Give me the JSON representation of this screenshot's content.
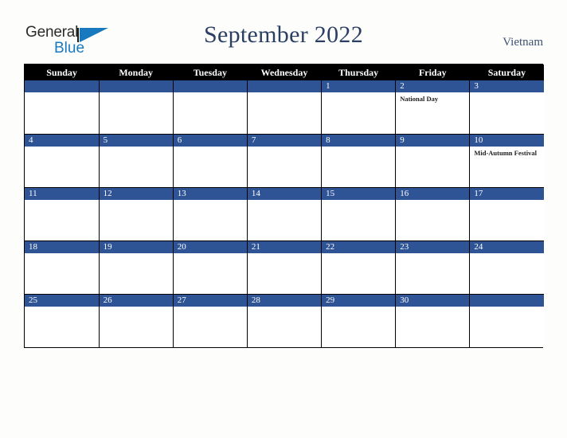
{
  "brand": {
    "name_part1": "General",
    "name_part2": "Blue",
    "triangle_icon": "triangle-icon",
    "accent_blue": "#1879bf"
  },
  "header": {
    "title": "September 2022",
    "country": "Vietnam",
    "title_color": "#2b3f63"
  },
  "calendar": {
    "weekday_headers": [
      "Sunday",
      "Monday",
      "Tuesday",
      "Wednesday",
      "Thursday",
      "Friday",
      "Saturday"
    ],
    "header_bg": "#000000",
    "header_text_color": "#ffffff",
    "daynum_bar_color": "#2f5496",
    "grid_line_color": "#000000",
    "cell_bg": "#ffffff",
    "weeks": [
      [
        {
          "day": "",
          "events": []
        },
        {
          "day": "",
          "events": []
        },
        {
          "day": "",
          "events": []
        },
        {
          "day": "",
          "events": []
        },
        {
          "day": "1",
          "events": []
        },
        {
          "day": "2",
          "events": [
            "National Day"
          ]
        },
        {
          "day": "3",
          "events": []
        }
      ],
      [
        {
          "day": "4",
          "events": []
        },
        {
          "day": "5",
          "events": []
        },
        {
          "day": "6",
          "events": []
        },
        {
          "day": "7",
          "events": []
        },
        {
          "day": "8",
          "events": []
        },
        {
          "day": "9",
          "events": []
        },
        {
          "day": "10",
          "events": [
            "Mid-Autumn Festival"
          ]
        }
      ],
      [
        {
          "day": "11",
          "events": []
        },
        {
          "day": "12",
          "events": []
        },
        {
          "day": "13",
          "events": []
        },
        {
          "day": "14",
          "events": []
        },
        {
          "day": "15",
          "events": []
        },
        {
          "day": "16",
          "events": []
        },
        {
          "day": "17",
          "events": []
        }
      ],
      [
        {
          "day": "18",
          "events": []
        },
        {
          "day": "19",
          "events": []
        },
        {
          "day": "20",
          "events": []
        },
        {
          "day": "21",
          "events": []
        },
        {
          "day": "22",
          "events": []
        },
        {
          "day": "23",
          "events": []
        },
        {
          "day": "24",
          "events": []
        }
      ],
      [
        {
          "day": "25",
          "events": []
        },
        {
          "day": "26",
          "events": []
        },
        {
          "day": "27",
          "events": []
        },
        {
          "day": "28",
          "events": []
        },
        {
          "day": "29",
          "events": []
        },
        {
          "day": "30",
          "events": []
        },
        {
          "day": "",
          "events": []
        }
      ]
    ]
  }
}
